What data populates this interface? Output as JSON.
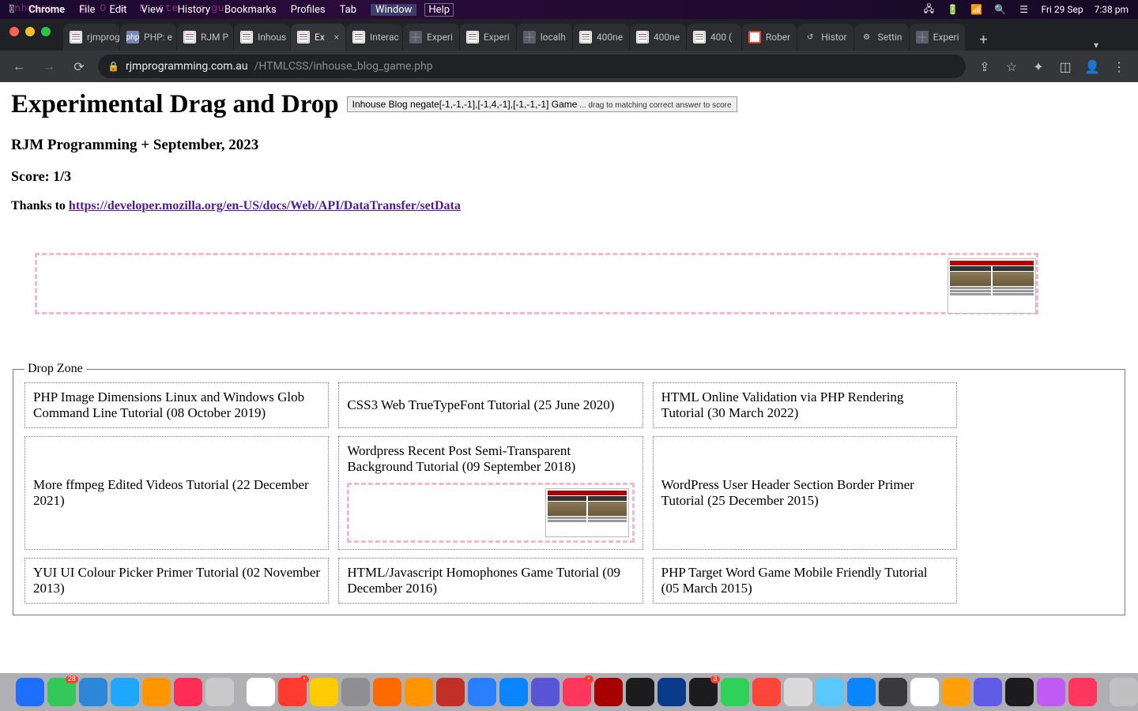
{
  "menubar": {
    "ghost": "Inhouse    g  O  e  B  tte   r gu    s  .",
    "app": "Chrome",
    "items": [
      "File",
      "Edit",
      "View",
      "History",
      "Bookmarks",
      "Profiles",
      "Tab",
      "Window",
      "Help"
    ],
    "right": {
      "date": "Fri 29 Sep",
      "time": "7:38 pm"
    }
  },
  "tabs": [
    {
      "label": "rjmprog",
      "fav": "note"
    },
    {
      "label": "PHP: e",
      "fav": "php"
    },
    {
      "label": "RJM P",
      "fav": "note"
    },
    {
      "label": "Inhous",
      "fav": "note"
    },
    {
      "label": "Ex",
      "fav": "note",
      "active": true,
      "close": true
    },
    {
      "label": "Interac",
      "fav": "note"
    },
    {
      "label": "Experi",
      "fav": "globe"
    },
    {
      "label": "Experi",
      "fav": "note"
    },
    {
      "label": "localh",
      "fav": "local"
    },
    {
      "label": "400ne",
      "fav": "note"
    },
    {
      "label": "400ne",
      "fav": "note"
    },
    {
      "label": "400 (",
      "fav": "note"
    },
    {
      "label": "Rober",
      "fav": "o"
    },
    {
      "label": "Histor",
      "fav": "hist"
    },
    {
      "label": "Settin",
      "fav": "gear"
    },
    {
      "label": "Experi",
      "fav": "globe"
    }
  ],
  "omnibox": {
    "host": "rjmprogramming.com.au",
    "path": "/HTMLCSS/inhouse_blog_game.php"
  },
  "page": {
    "title": "Experimental Drag and Drop",
    "button_main": "Inhouse Blog negate[-1,-1,-1],[-1,4,-1],[-1,-1,-1] Game",
    "button_hint": " ... drag to matching correct answer to score",
    "sub1": "RJM Programming + September, 2023",
    "score": "Score: 1/3",
    "thanks_prefix": "Thanks to ",
    "thanks_link": "https://developer.mozilla.org/en-US/docs/Web/API/DataTransfer/setData",
    "dropzone_legend": "Drop Zone",
    "cells": [
      "PHP Image Dimensions Linux and Windows Glob Command Line Tutorial (08 October 2019)",
      "CSS3 Web TrueTypeFont Tutorial (25 June 2020)",
      "HTML Online Validation via PHP Rendering Tutorial (30 March 2022)",
      "More ffmpeg Edited Videos Tutorial (22 December 2021)",
      "Wordpress Recent Post Semi-Transparent Background Tutorial (09 September 2018)",
      "WordPress User Header Section Border Primer Tutorial (25 December 2015)",
      "YUI UI Colour Picker Primer Tutorial (02 November 2013)",
      "HTML/Javascript Homophones Game Tutorial (09 December 2016)",
      "PHP Target Word Game Mobile Friendly Tutorial (05 March 2015)"
    ]
  },
  "dock_colors": [
    "#1e6fff",
    "#34c759",
    "#2b88d8",
    "#1ea7fd",
    "#ff9500",
    "#ff2d55",
    "#c9c9c9",
    "#ffffff",
    "#ff3b30",
    "#ffcc00",
    "#8e8e93",
    "#ff6a00",
    "#ff9500",
    "#c03028",
    "#2a7fff",
    "#0a84ff",
    "#5856d6",
    "#ff375f",
    "#a80000",
    "#1c1c1e",
    "#0a3a8a",
    "#1c1c1e",
    "#30d158",
    "#ff453a",
    "#d9d9d9",
    "#5ac8fa",
    "#0a84ff",
    "#3a3a3c",
    "#ffffff",
    "#ff9f0a",
    "#5e5ce6",
    "#1c1c1e",
    "#bf5af2",
    "#ff375f",
    "#c0c0c0",
    "#4040aa",
    "#6a5acd",
    "#34c759",
    "#ffcc00",
    "#22668a",
    "#3a7a3a",
    "#2266cc",
    "#555555"
  ],
  "dock_badges": {
    "1": "28",
    "8": "•",
    "17": "•",
    "21": "3"
  }
}
